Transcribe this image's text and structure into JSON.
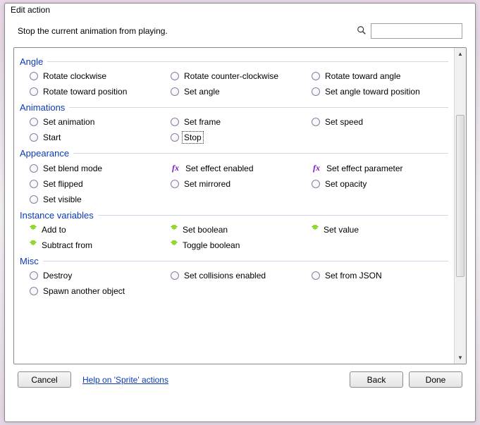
{
  "window": {
    "title": "Edit action"
  },
  "heading": "Stop the current animation from playing.",
  "search": {
    "placeholder": ""
  },
  "groups": [
    {
      "title": "Angle",
      "items": [
        {
          "icon": "radio",
          "label": "Rotate clockwise"
        },
        {
          "icon": "radio",
          "label": "Rotate counter-clockwise"
        },
        {
          "icon": "radio",
          "label": "Rotate toward angle"
        },
        {
          "icon": "radio",
          "label": "Rotate toward position"
        },
        {
          "icon": "radio",
          "label": "Set angle"
        },
        {
          "icon": "radio",
          "label": "Set angle toward position"
        }
      ]
    },
    {
      "title": "Animations",
      "items": [
        {
          "icon": "radio",
          "label": "Set animation"
        },
        {
          "icon": "radio",
          "label": "Set frame"
        },
        {
          "icon": "radio",
          "label": "Set speed"
        },
        {
          "icon": "radio",
          "label": "Start"
        },
        {
          "icon": "radio",
          "label": "Stop",
          "selected": true
        },
        null
      ]
    },
    {
      "title": "Appearance",
      "items": [
        {
          "icon": "radio",
          "label": "Set blend mode"
        },
        {
          "icon": "fx",
          "label": "Set effect enabled"
        },
        {
          "icon": "fx",
          "label": "Set effect parameter"
        },
        {
          "icon": "radio",
          "label": "Set flipped"
        },
        {
          "icon": "radio",
          "label": "Set mirrored"
        },
        {
          "icon": "radio",
          "label": "Set opacity"
        },
        {
          "icon": "radio",
          "label": "Set visible"
        },
        null,
        null
      ]
    },
    {
      "title": "Instance variables",
      "items": [
        {
          "icon": "var",
          "label": "Add to"
        },
        {
          "icon": "var",
          "label": "Set boolean"
        },
        {
          "icon": "var",
          "label": "Set value"
        },
        {
          "icon": "var",
          "label": "Subtract from"
        },
        {
          "icon": "var",
          "label": "Toggle boolean"
        },
        null
      ]
    },
    {
      "title": "Misc",
      "items": [
        {
          "icon": "radio",
          "label": "Destroy"
        },
        {
          "icon": "radio",
          "label": "Set collisions enabled"
        },
        {
          "icon": "radio",
          "label": "Set from JSON"
        },
        {
          "icon": "radio",
          "label": "Spawn another object"
        },
        null,
        null
      ]
    }
  ],
  "footer": {
    "cancel": "Cancel",
    "help": "Help on 'Sprite' actions",
    "back": "Back",
    "done": "Done"
  }
}
